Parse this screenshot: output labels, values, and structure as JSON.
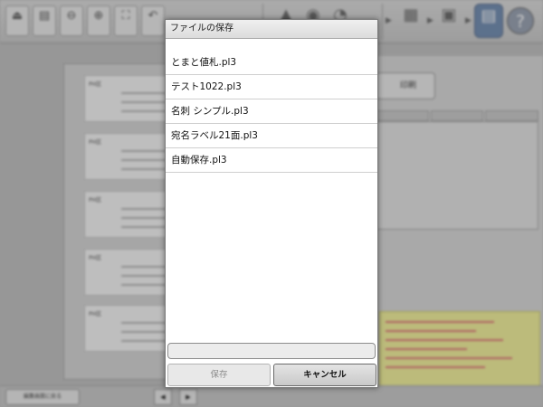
{
  "dialog": {
    "title": "ファイルの保存",
    "files": [
      "とまと値札.pl3",
      "テスト1022.pl3",
      "名刺 シンプル.pl3",
      "宛名ラベル21面.pl3",
      "自動保存.pl3"
    ],
    "filename_value": "",
    "save_label": "保存",
    "cancel_label": "キャンセル"
  },
  "background": {
    "print_label": "印刷",
    "back_label": "編集画面に戻る"
  },
  "colors": {
    "dialog_bg": "#ffffff",
    "active_step": "#5f7ea8",
    "warning_bg": "#f1f08e"
  }
}
